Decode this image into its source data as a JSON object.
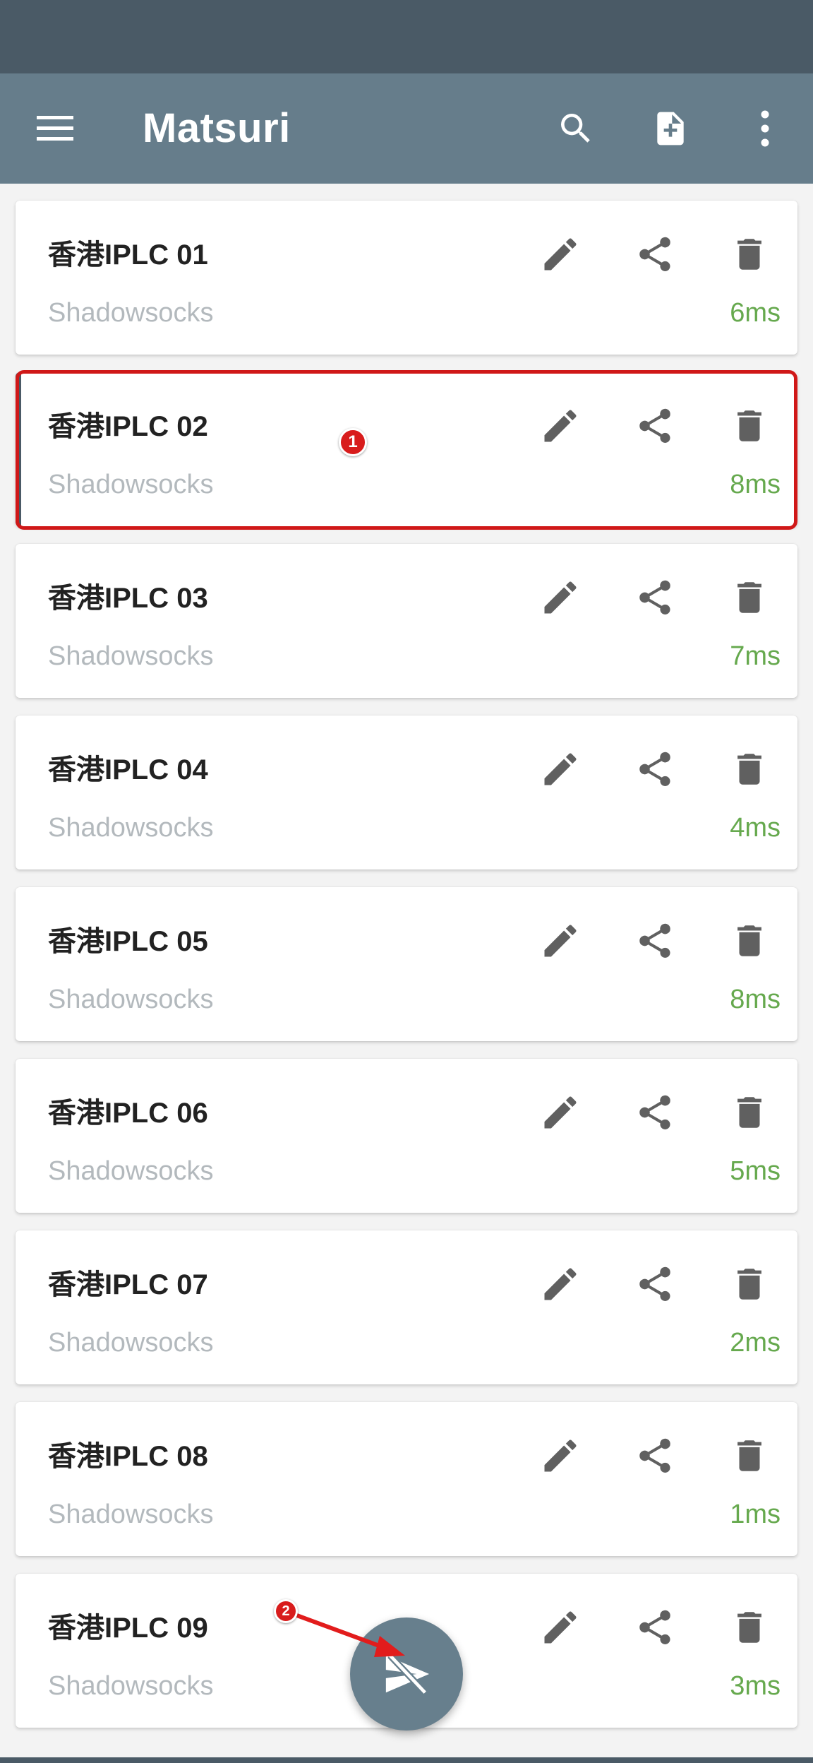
{
  "app": {
    "title": "Matsuri"
  },
  "icons": {
    "menu": "menu-icon",
    "search": "search-icon",
    "add_file": "add-file-icon",
    "more": "more-vert-icon",
    "edit": "edit-icon",
    "share": "share-icon",
    "delete": "delete-icon",
    "fab": "send-disconnected-icon"
  },
  "colors": {
    "status_bar": "#4a5a66",
    "app_bar": "#667d8b",
    "latency": "#66a94e",
    "highlight": "#d01818"
  },
  "annotations": {
    "marker_1": "1",
    "marker_2": "2"
  },
  "profiles": [
    {
      "name": "香港IPLC 01",
      "type": "Shadowsocks",
      "latency": "6ms"
    },
    {
      "name": "香港IPLC 02",
      "type": "Shadowsocks",
      "latency": "8ms",
      "selected": true
    },
    {
      "name": "香港IPLC 03",
      "type": "Shadowsocks",
      "latency": "7ms"
    },
    {
      "name": "香港IPLC 04",
      "type": "Shadowsocks",
      "latency": "4ms"
    },
    {
      "name": "香港IPLC 05",
      "type": "Shadowsocks",
      "latency": "8ms"
    },
    {
      "name": "香港IPLC 06",
      "type": "Shadowsocks",
      "latency": "5ms"
    },
    {
      "name": "香港IPLC 07",
      "type": "Shadowsocks",
      "latency": "2ms"
    },
    {
      "name": "香港IPLC 08",
      "type": "Shadowsocks",
      "latency": "1ms"
    },
    {
      "name": "香港IPLC 09",
      "type": "Shadowsocks",
      "latency": "3ms"
    }
  ]
}
